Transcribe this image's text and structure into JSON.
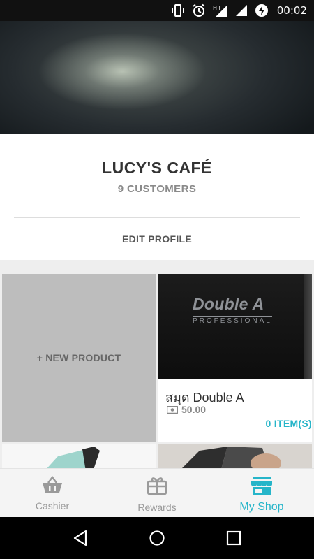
{
  "status_bar": {
    "time": "00:02",
    "icons": [
      "vibrate-icon",
      "alarm-icon",
      "hplus-signal-icon",
      "wifi-signal-icon",
      "battery-charging-icon"
    ]
  },
  "profile": {
    "shop_name": "LUCY'S CAFÉ",
    "customers": "9 CUSTOMERS",
    "edit_label": "EDIT PROFILE"
  },
  "products": {
    "new_label": "+ NEW PRODUCT",
    "items": [
      {
        "brand": "Double A",
        "brand_sub": "PROFESSIONAL",
        "name": "สมุด Double A",
        "price": "50.00",
        "items": "0 ITEM(S)"
      }
    ]
  },
  "bottom_nav": {
    "items": [
      {
        "label": "Cashier",
        "icon": "basket-icon",
        "active": false
      },
      {
        "label": "Rewards",
        "icon": "gift-icon",
        "active": false
      },
      {
        "label": "My Shop",
        "icon": "shop-icon",
        "active": true
      }
    ]
  },
  "colors": {
    "accent": "#26b5c9",
    "inactive": "#9a9a9a",
    "tile_gray": "#bdbdbd"
  }
}
